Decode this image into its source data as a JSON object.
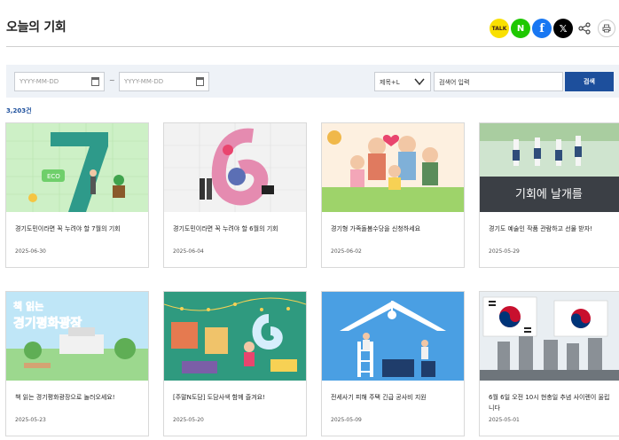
{
  "page": {
    "title": "오늘의 기회"
  },
  "share": {
    "kakao": "TALK",
    "naver": "N",
    "facebook": "f",
    "x": "𝕏",
    "share_symbol": "⋖",
    "print_symbol": "⎙"
  },
  "search": {
    "start_placeholder": "YYYY-MM-DD",
    "end_placeholder": "YYYY-MM-DD",
    "range_separator": "~",
    "field_select": "제목+L",
    "keyword_placeholder": "검색어 입력",
    "button_label": "검색"
  },
  "result_count": "3,203건",
  "cards": [
    {
      "title": "경기도민이라면 꼭 누려야 할 7월의 기회",
      "date": "2025-06-30",
      "icon": "number-seven-eco-illustration"
    },
    {
      "title": "경기도민이라면 꼭 누려야 할 6월의 기회",
      "date": "2025-06-04",
      "icon": "number-six-illustration"
    },
    {
      "title": "경기형 가족돌봄수당을 신청하세요",
      "date": "2025-06-02",
      "icon": "family-illustration"
    },
    {
      "title": "경기도 예술인 작품 관람하고 선물 받자!",
      "date": "2025-05-29",
      "icon": "dancers-photo",
      "image_text": "기회에 날개를"
    },
    {
      "title": "책 읽는 경기평화광장으로 놀러오세요!",
      "date": "2025-05-23",
      "icon": "plaza-illustration",
      "image_text_top": "책 읽는",
      "image_text_main": "경기평화광장"
    },
    {
      "title": "[주말N도담] 도담사색 함께 즐겨요!",
      "date": "2025-05-20",
      "icon": "market-illustration"
    },
    {
      "title": "전세사기 피해 주택 긴급 공사비 지원",
      "date": "2025-05-09",
      "icon": "repair-illustration"
    },
    {
      "title": "6월 6일 오전 10시 현충일 추념 사이렌이 울립니다",
      "date": "2025-05-01",
      "icon": "memorial-flags-photo"
    }
  ],
  "colors": {
    "accent": "#1d4f9c",
    "panel": "#eef2f7"
  }
}
